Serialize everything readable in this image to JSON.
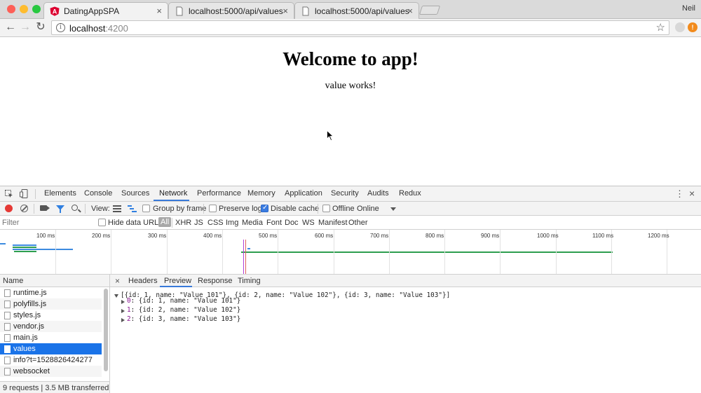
{
  "browser": {
    "tabs": [
      {
        "title": "DatingAppSPA",
        "active": true,
        "icon": "angular-icon"
      },
      {
        "title": "localhost:5000/api/values",
        "active": false,
        "icon": "page-icon"
      },
      {
        "title": "localhost:5000/api/values",
        "active": false,
        "icon": "page-icon"
      }
    ],
    "profile": "Neil",
    "url_host": "localhost",
    "url_port": ":4200",
    "colors": {
      "close": "#fd5f57",
      "minimize": "#febc2e",
      "maximize": "#28c840",
      "angular": "#dd0031"
    }
  },
  "page": {
    "heading": "Welcome to app!",
    "message": "value works!"
  },
  "devtools": {
    "panels": [
      "Elements",
      "Console",
      "Sources",
      "Network",
      "Performance",
      "Memory",
      "Application",
      "Security",
      "Audits",
      "Redux"
    ],
    "active_panel": "Network",
    "view_label": "View:",
    "group_by_frame": "Group by frame",
    "preserve_log": "Preserve log",
    "disable_cache": "Disable cache",
    "offline": "Offline",
    "throttle": "Online",
    "filter_placeholder": "Filter",
    "hide_data_urls": "Hide data URLs",
    "type_filters": [
      "All",
      "XHR",
      "JS",
      "CSS",
      "Img",
      "Media",
      "Font",
      "Doc",
      "WS",
      "Manifest",
      "Other"
    ],
    "ticks": [
      "100 ms",
      "200 ms",
      "300 ms",
      "400 ms",
      "500 ms",
      "600 ms",
      "700 ms",
      "800 ms",
      "900 ms",
      "1000 ms",
      "1100 ms",
      "1200 ms"
    ],
    "name_header": "Name",
    "requests": [
      "runtime.js",
      "polyfills.js",
      "styles.js",
      "vendor.js",
      "main.js",
      "values",
      "info?t=1528826424277",
      "websocket"
    ],
    "selected_request": "values",
    "summary": "9 requests | 3.5 MB transferred | ...",
    "detail_tabs": [
      "Headers",
      "Preview",
      "Response",
      "Timing"
    ],
    "active_detail_tab": "Preview",
    "preview": {
      "root": "[{id: 1, name: \"Value 101\"}, {id: 2, name: \"Value 102\"}, {id: 3, name: \"Value 103\"}]",
      "items": [
        {
          "index": "0",
          "text": ": {id: 1, name: \"Value 101\"}"
        },
        {
          "index": "1",
          "text": ": {id: 2, name: \"Value 102\"}"
        },
        {
          "index": "2",
          "text": ": {id: 3, name: \"Value 103\"}"
        }
      ]
    },
    "colors": {
      "accent": "#1a73e8",
      "record": "#e53935",
      "waterfall_green": "#2e9e4f",
      "waterfall_blue": "#3d8be0"
    }
  }
}
